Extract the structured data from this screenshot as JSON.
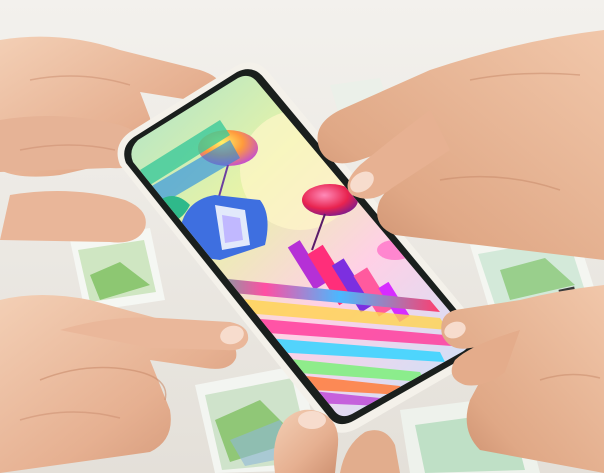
{
  "scene": {
    "subject": "hands-holding-smartphone",
    "colors": {
      "background": "#ece9e4",
      "phone_frame": "#f4f1ea",
      "phone_bezel": "#1a1f1d",
      "skin_light": "#f0c9ae",
      "skin_mid": "#e2ad8d",
      "skin_shadow": "#c98c6d",
      "nail": "#f7dccd",
      "paper": "#f4f6f2",
      "paper_green": "#8ac46a",
      "paper_blue": "#8fb8d9"
    }
  }
}
